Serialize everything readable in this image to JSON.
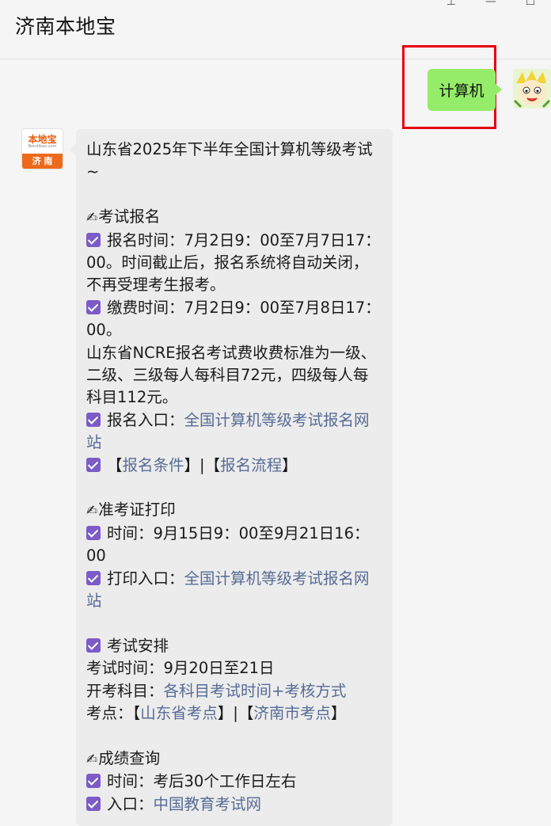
{
  "window": {
    "title": "济南本地宝",
    "controls": [
      "pin-icon",
      "minimize-icon",
      "maximize-icon"
    ]
  },
  "user_message": {
    "text": "计算机",
    "avatar": "cartoon-avatar"
  },
  "bot": {
    "avatar_top": "本地宝",
    "avatar_sub": "Bendibao.com",
    "avatar_bottom": "济 南"
  },
  "reply": {
    "intro": "山东省2025年下半年全国计算机等级考试~",
    "reg_heading": "考试报名",
    "reg_time_label": "报名时间：",
    "reg_time_value": "7月2日9：00至7月7日17：00。时间截止后，报名系统将自动关闭，不再受理考生报考。",
    "pay_time_label": "缴费时间：",
    "pay_time_value": "7月2日9：00至7月8日17：00。",
    "fee_text": "山东省NCRE报名考试费收费标准为一级、二级、三级每人每科目72元，四级每人每科目112元。",
    "reg_entry_label": "报名入口：",
    "reg_entry_link": "全国计算机等级考试报名网站",
    "cond_open": "【",
    "cond_link": "报名条件",
    "cond_sep": "】|【",
    "proc_link": "报名流程",
    "cond_close": "】",
    "ticket_heading": "准考证打印",
    "ticket_time_label": "时间：",
    "ticket_time_value": "9月15日9：00至9月21日16：00",
    "ticket_entry_label": "打印入口：",
    "ticket_entry_link": "全国计算机等级考试报名网站",
    "arrange_heading": "考试安排",
    "exam_time_label": "考试时间：",
    "exam_time_value": "9月20日至21日",
    "subjects_label": "开考科目：",
    "subjects_link": "各科目考试时间+考核方式",
    "venue_label": "考点：【",
    "venue_link1": "山东省考点",
    "venue_sep": "】|【",
    "venue_link2": "济南市考点",
    "venue_close": "】",
    "score_heading": "成绩查询",
    "score_time_label": "时间：",
    "score_time_value": "考后30个工作日左右",
    "score_entry_label": "入口：",
    "score_entry_link": "中国教育考试网"
  },
  "colors": {
    "user_bubble": "#95ec69",
    "bot_bubble": "#ececec",
    "link": "#576b95",
    "checkbox": "#7b5cc7",
    "highlight": "#e60012"
  }
}
